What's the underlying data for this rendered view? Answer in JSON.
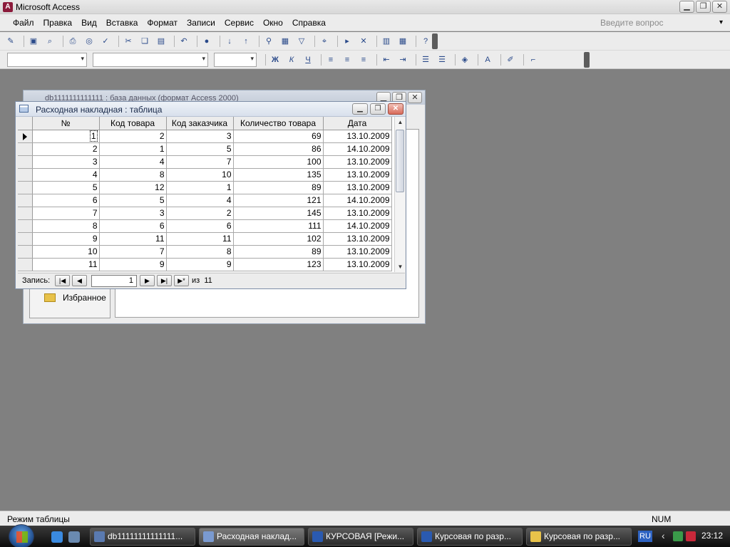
{
  "app": {
    "title": "Microsoft Access"
  },
  "menu": {
    "items": [
      "Файл",
      "Правка",
      "Вид",
      "Вставка",
      "Формат",
      "Записи",
      "Сервис",
      "Окно",
      "Справка"
    ],
    "ask_placeholder": "Введите вопрос"
  },
  "db_window": {
    "title": "db1111111111111 : база данных (формат Access 2000)",
    "favorites": "Избранное"
  },
  "table_window": {
    "title": "Расходная накладная : таблица",
    "columns": [
      "№",
      "Код товара",
      "Код заказчика",
      "Количество товара",
      "Дата"
    ],
    "rows": [
      [
        "1",
        "2",
        "3",
        "69",
        "13.10.2009"
      ],
      [
        "2",
        "1",
        "5",
        "86",
        "14.10.2009"
      ],
      [
        "3",
        "4",
        "7",
        "100",
        "13.10.2009"
      ],
      [
        "4",
        "8",
        "10",
        "135",
        "13.10.2009"
      ],
      [
        "5",
        "12",
        "1",
        "89",
        "13.10.2009"
      ],
      [
        "6",
        "5",
        "4",
        "121",
        "14.10.2009"
      ],
      [
        "7",
        "3",
        "2",
        "145",
        "13.10.2009"
      ],
      [
        "8",
        "6",
        "6",
        "111",
        "14.10.2009"
      ],
      [
        "9",
        "11",
        "11",
        "102",
        "13.10.2009"
      ],
      [
        "10",
        "7",
        "8",
        "89",
        "13.10.2009"
      ],
      [
        "11",
        "9",
        "9",
        "123",
        "13.10.2009"
      ]
    ],
    "nav": {
      "label": "Запись:",
      "current": "1",
      "of_label": "из",
      "total": "11"
    }
  },
  "status": {
    "mode": "Режим таблицы",
    "num": "NUM"
  },
  "taskbar": {
    "items": [
      "db11111111111111...",
      "Расходная наклад...",
      "КУРСОВАЯ [Режи...",
      "Курсовая по разр...",
      "Курсовая по разр..."
    ],
    "lang": "RU",
    "time": "23:12"
  },
  "colors": {
    "titlebar_close": "#d86a5a",
    "lang_badge": "#2e63c2",
    "access_brand": "#8b1a3b"
  }
}
